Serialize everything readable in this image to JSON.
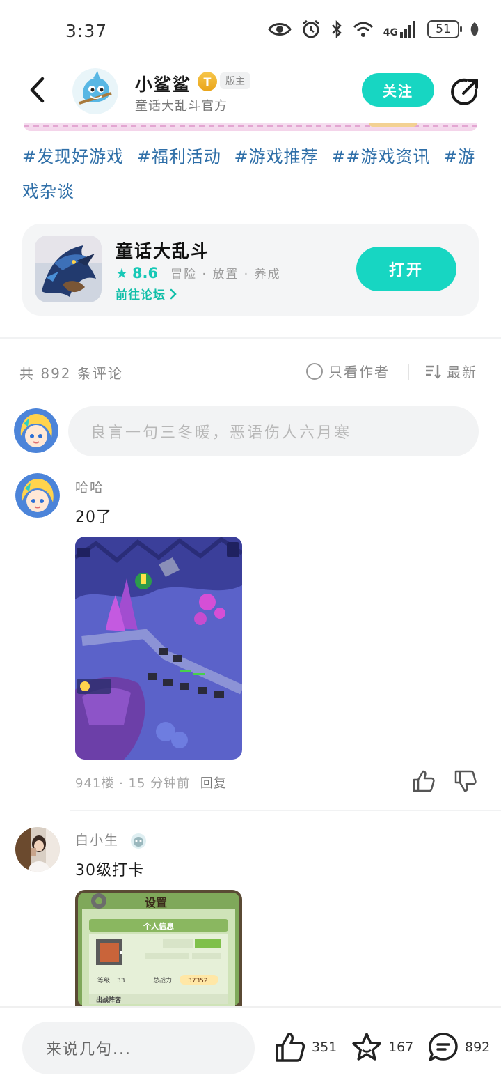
{
  "status_bar": {
    "time": "3:37",
    "network": "4G",
    "battery": "51"
  },
  "header": {
    "author_name": "小鲨鲨",
    "level_badge": "T",
    "role_badge": "版主",
    "subtitle": "童话大乱斗官方",
    "follow_label": "关注"
  },
  "tags": [
    "#发现好游戏",
    "#福利活动",
    "#游戏推荐",
    "##游戏资讯",
    "#游戏杂谈"
  ],
  "game_card": {
    "name": "童话大乱斗",
    "rating": "8.6",
    "genres": "冒险 · 放置 · 养成",
    "forum_link": "前往论坛",
    "open_label": "打开"
  },
  "comment_bar": {
    "count_text": "共 892 条评论",
    "author_only": "只看作者",
    "sort": "最新",
    "input_placeholder": "良言一句三冬暖，恶语伤人六月寒"
  },
  "comments": [
    {
      "user": "哈哈",
      "text": "20了",
      "meta": "941楼 · 15 分钟前",
      "reply": "回复"
    },
    {
      "user": "白小生",
      "text": "30级打卡"
    }
  ],
  "screenshot_text": {
    "settings_title": "设置",
    "personal_info": "个人信息",
    "level_label": "等级",
    "level_value": "33",
    "power_label": "总战力",
    "power_value": "37352",
    "lineup_label": "出战阵容"
  },
  "bottom_bar": {
    "input_placeholder": "来说几句...",
    "likes": "351",
    "favorites": "167",
    "comments": "892"
  },
  "colors": {
    "accent": "#17d6c2",
    "tag_blue": "#2f6fa8",
    "forum_link": "#12bfa9"
  }
}
